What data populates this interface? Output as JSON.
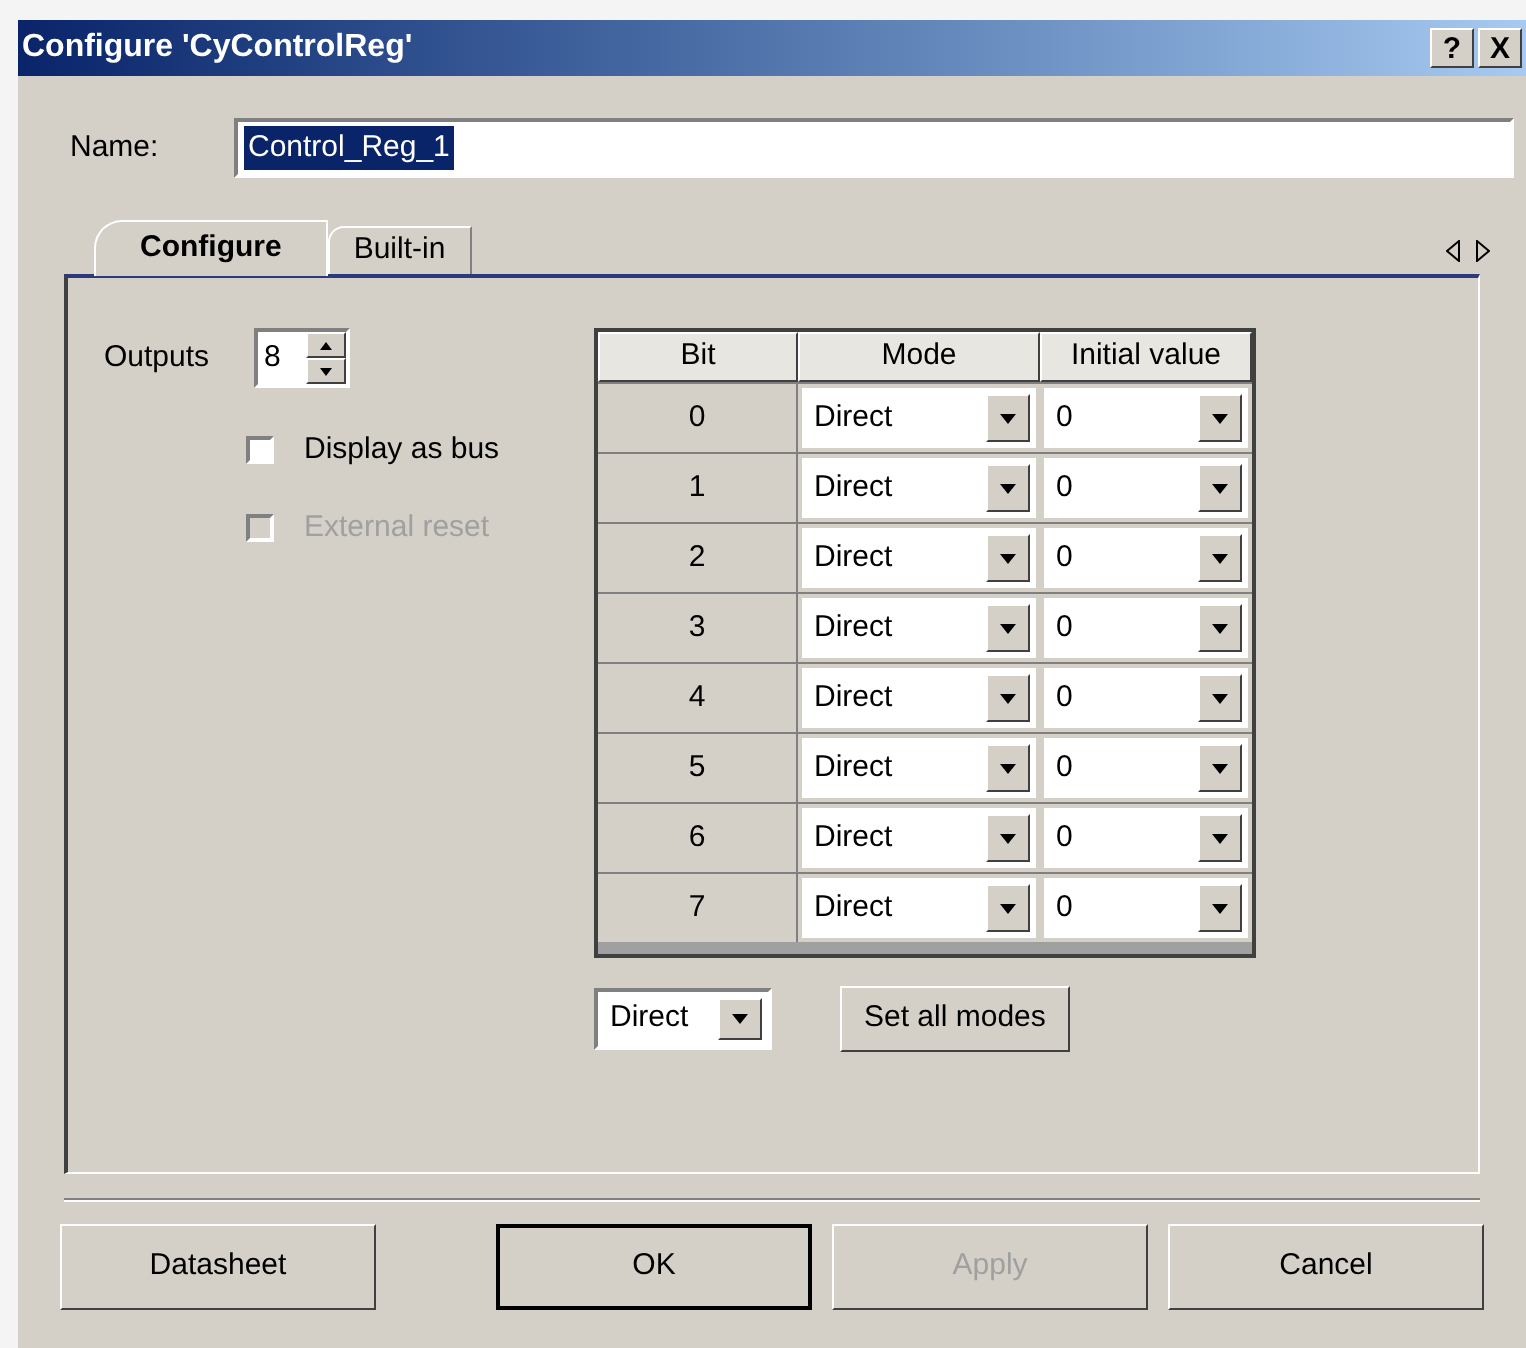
{
  "window": {
    "title": "Configure 'CyControlReg'",
    "title_buttons": [
      "?",
      "X"
    ]
  },
  "name": {
    "label": "Name:",
    "value": "Control_Reg_1",
    "text_selected": true
  },
  "tabs": [
    {
      "label": "Configure",
      "selected": true
    },
    {
      "label": "Built-in",
      "selected": false
    }
  ],
  "outputs": {
    "label": "Outputs",
    "value": "8"
  },
  "checkboxes": [
    {
      "label": "Display as bus",
      "checked": false,
      "disabled": false
    },
    {
      "label": "External reset",
      "checked": false,
      "disabled": true
    }
  ],
  "table": {
    "columns": [
      "Bit",
      "Mode",
      "Initial value"
    ],
    "rows": [
      {
        "bit": "0",
        "mode": "Direct",
        "initial_value": "0"
      },
      {
        "bit": "1",
        "mode": "Direct",
        "initial_value": "0"
      },
      {
        "bit": "2",
        "mode": "Direct",
        "initial_value": "0"
      },
      {
        "bit": "3",
        "mode": "Direct",
        "initial_value": "0"
      },
      {
        "bit": "4",
        "mode": "Direct",
        "initial_value": "0"
      },
      {
        "bit": "5",
        "mode": "Direct",
        "initial_value": "0"
      },
      {
        "bit": "6",
        "mode": "Direct",
        "initial_value": "0"
      },
      {
        "bit": "7",
        "mode": "Direct",
        "initial_value": "0"
      }
    ]
  },
  "mode_picker": {
    "value": "Direct"
  },
  "set_all_button": "Set all modes",
  "buttons": [
    {
      "label": "Datasheet",
      "default": false,
      "disabled": false
    },
    {
      "label": "OK",
      "default": true,
      "disabled": false
    },
    {
      "label": "Apply",
      "default": false,
      "disabled": true
    },
    {
      "label": "Cancel",
      "default": false,
      "disabled": false
    }
  ]
}
